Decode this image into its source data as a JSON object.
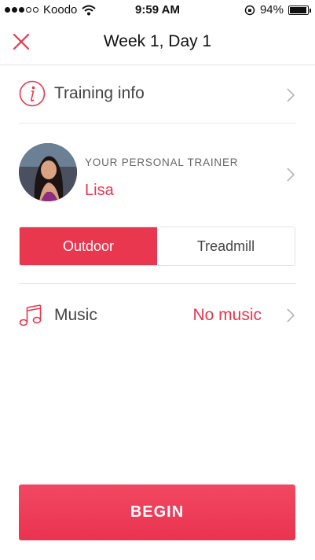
{
  "status_bar": {
    "carrier": "Koodo",
    "time": "9:59 AM",
    "battery_percent": "94%",
    "battery_level": 0.94
  },
  "nav": {
    "title": "Week 1, Day 1",
    "close_icon": "close-icon"
  },
  "training_info": {
    "label": "Training info",
    "icon": "info-icon"
  },
  "trainer": {
    "caption": "YOUR PERSONAL TRAINER",
    "name": "Lisa"
  },
  "mode_toggle": {
    "options": [
      "Outdoor",
      "Treadmill"
    ],
    "selected": "Outdoor"
  },
  "music": {
    "label": "Music",
    "value": "No music",
    "icon": "music-note-icon"
  },
  "begin_button": {
    "label": "BEGIN"
  },
  "colors": {
    "accent": "#e9374f",
    "divider": "#e8e8e8"
  }
}
